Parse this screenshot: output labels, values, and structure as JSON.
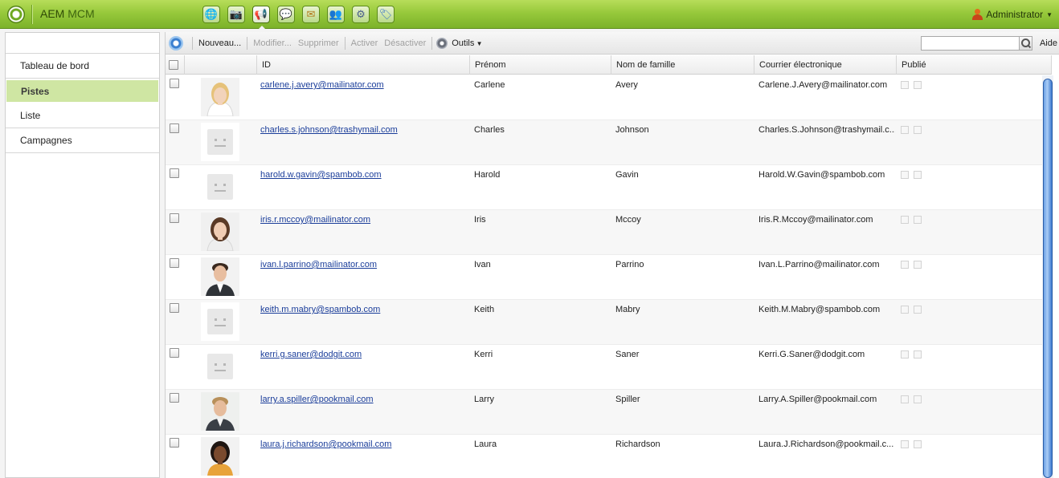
{
  "header": {
    "app_name": "AEM",
    "app_subtitle": "MCM",
    "user": "Administrator",
    "nav_icons": [
      "globe-icon",
      "camera-icon",
      "megaphone-icon",
      "comment-icon",
      "envelope-icon",
      "people-icon",
      "gears-icon",
      "tag-icon"
    ],
    "active_nav": "megaphone-icon"
  },
  "sidebar": {
    "items": [
      {
        "label": "Tableau de bord"
      },
      {
        "label": "Pistes"
      },
      {
        "label": "Liste"
      },
      {
        "label": "Campagnes"
      }
    ],
    "active": "Pistes"
  },
  "toolbar": {
    "new_label": "Nouveau...",
    "modify_label": "Modifier...",
    "delete_label": "Supprimer",
    "activate_label": "Activer",
    "deactivate_label": "Désactiver",
    "tools_label": "Outils",
    "search_placeholder": "",
    "help_label": "Aide"
  },
  "grid": {
    "columns": [
      "ID",
      "Prénom",
      "Nom de famille",
      "Courrier électronique",
      "Publié"
    ],
    "rows": [
      {
        "id": "carlene.j.avery@mailinator.com",
        "first": "Carlene",
        "last": "Avery",
        "email": "Carlene.J.Avery@mailinator.com",
        "avatar": "photo-woman-blonde"
      },
      {
        "id": "charles.s.johnson@trashymail.com",
        "first": "Charles",
        "last": "Johnson",
        "email": "Charles.S.Johnson@trashymail.c...",
        "avatar": "placeholder"
      },
      {
        "id": "harold.w.gavin@spambob.com",
        "first": "Harold",
        "last": "Gavin",
        "email": "Harold.W.Gavin@spambob.com",
        "avatar": "placeholder"
      },
      {
        "id": "iris.r.mccoy@mailinator.com",
        "first": "Iris",
        "last": "Mccoy",
        "email": "Iris.R.Mccoy@mailinator.com",
        "avatar": "photo-woman-brunette"
      },
      {
        "id": "ivan.l.parrino@mailinator.com",
        "first": "Ivan",
        "last": "Parrino",
        "email": "Ivan.L.Parrino@mailinator.com",
        "avatar": "photo-man-suit"
      },
      {
        "id": "keith.m.mabry@spambob.com",
        "first": "Keith",
        "last": "Mabry",
        "email": "Keith.M.Mabry@spambob.com",
        "avatar": "placeholder"
      },
      {
        "id": "kerri.g.saner@dodgit.com",
        "first": "Kerri",
        "last": "Saner",
        "email": "Kerri.G.Saner@dodgit.com",
        "avatar": "placeholder"
      },
      {
        "id": "larry.a.spiller@pookmail.com",
        "first": "Larry",
        "last": "Spiller",
        "email": "Larry.A.Spiller@pookmail.com",
        "avatar": "photo-man-blond"
      },
      {
        "id": "laura.j.richardson@pookmail.com",
        "first": "Laura",
        "last": "Richardson",
        "email": "Laura.J.Richardson@pookmail.c...",
        "avatar": "photo-woman-smiling"
      }
    ]
  },
  "colors": {
    "topbar_green": "#97c93b",
    "sidebar_active": "#cfe6a3",
    "link_blue": "#1a3d9a"
  }
}
